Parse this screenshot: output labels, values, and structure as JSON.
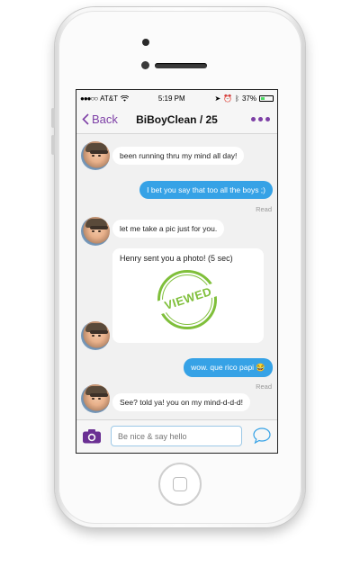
{
  "status_bar": {
    "carrier": "AT&T",
    "time": "5:19 PM",
    "battery": "37%",
    "battery_level": 0.37,
    "dots": "●●●○○"
  },
  "nav": {
    "back_label": "Back",
    "title": "BiBoyClean / 25"
  },
  "messages": {
    "m1": "been running thru my mind all day!",
    "m2": "I bet you say that too all the boys ;)",
    "read1": "Read",
    "m3": "let me take a pic just for you.",
    "photo_notice": "Henry sent you a photo! (5 sec)",
    "photo_stamp": "VIEWED",
    "m4": "wow. que rico papi 😂",
    "read2": "Read",
    "m5": "See? told ya! you on my mind-d-d-d!"
  },
  "composer": {
    "placeholder": "Be nice & say hello"
  },
  "colors": {
    "accent": "#7d3fa6",
    "outgoing_bubble": "#36a2e6",
    "stamp": "#7fbf3a"
  }
}
